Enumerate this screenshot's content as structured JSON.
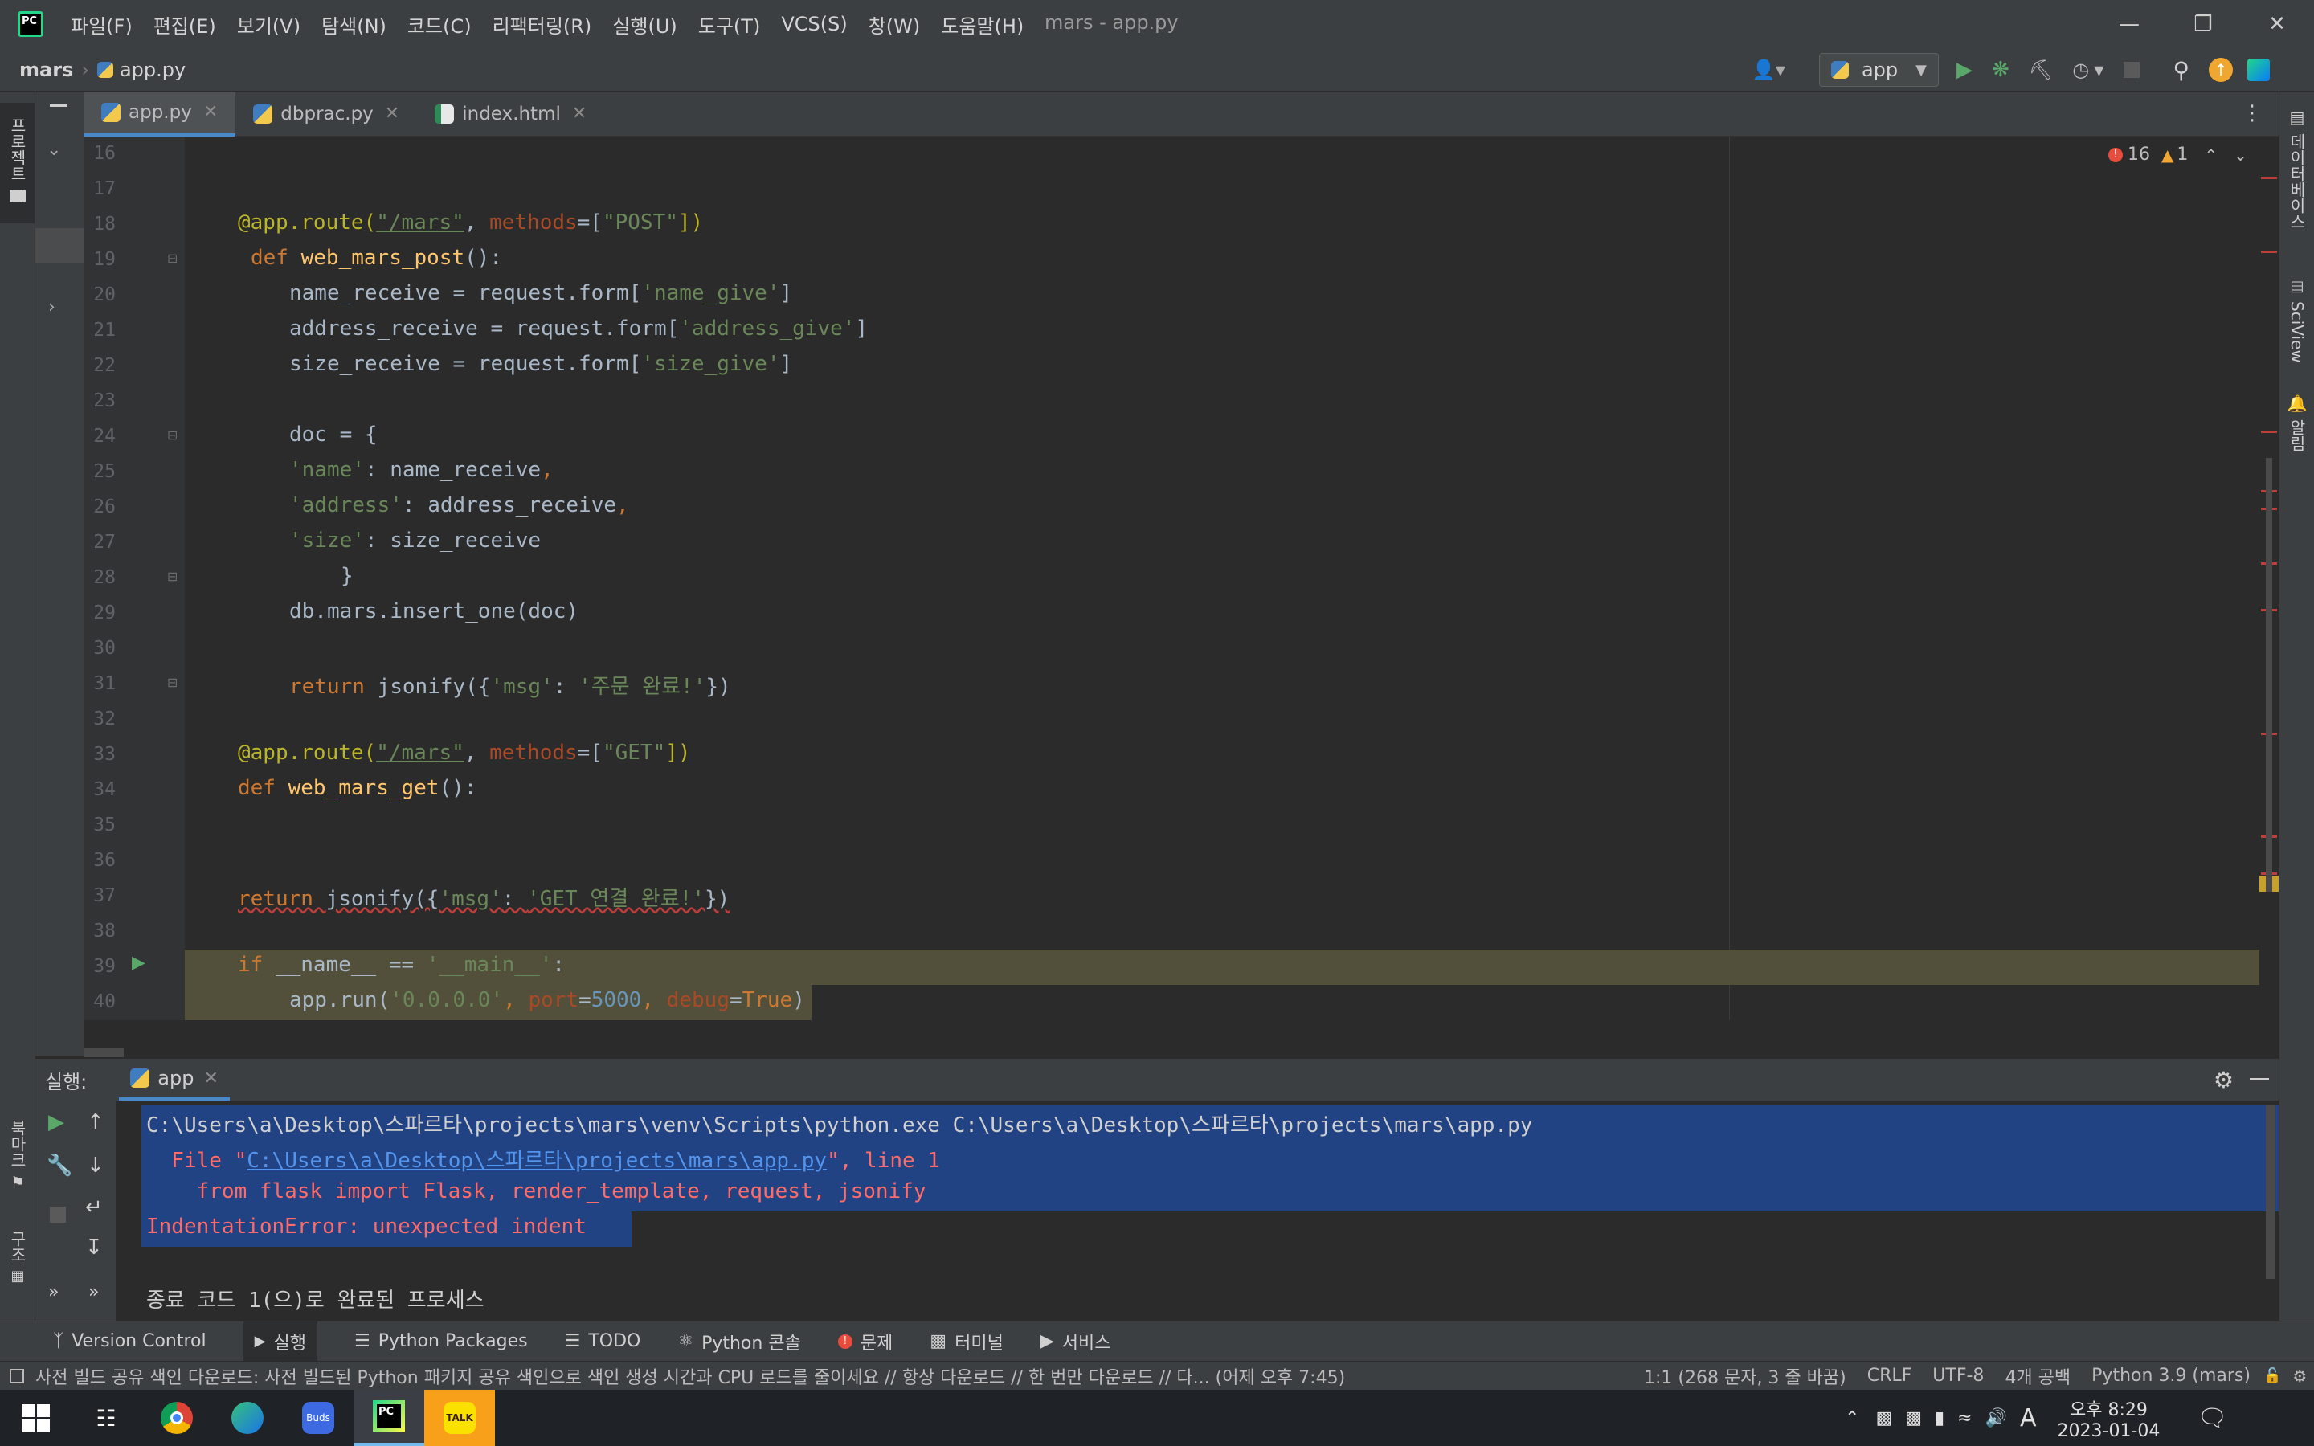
{
  "app": {
    "logo": "PC",
    "window_title": "mars - app.py"
  },
  "menu": [
    "파일(F)",
    "편집(E)",
    "보기(V)",
    "탐색(N)",
    "코드(C)",
    "리팩터링(R)",
    "실행(U)",
    "도구(T)",
    "VCS(S)",
    "창(W)",
    "도움말(H)"
  ],
  "nav": {
    "project": "mars",
    "file": "app.py",
    "run_config": "app"
  },
  "left_strip": {
    "project_label": "프로젝트",
    "bookmarks_label": "북마크",
    "structure_label": "구조"
  },
  "right_strip": {
    "database_label": "데이터베이스",
    "sciview_label": "SciView",
    "notifications_label": "알림"
  },
  "tabs": [
    {
      "label": "app.py",
      "icon": "python-file-icon",
      "active": true
    },
    {
      "label": "dbprac.py",
      "icon": "python-file-icon",
      "active": false
    },
    {
      "label": "index.html",
      "icon": "html-file-icon",
      "active": false
    }
  ],
  "inspections": {
    "errors": "16",
    "warnings": "1"
  },
  "line_numbers": [
    "16",
    "17",
    "18",
    "19",
    "20",
    "21",
    "22",
    "23",
    "24",
    "25",
    "26",
    "27",
    "28",
    "29",
    "30",
    "31",
    "32",
    "33",
    "34",
    "35",
    "36",
    "37",
    "38",
    "39",
    "40"
  ],
  "code": {
    "l18": {
      "a": "@app.route(",
      "b": "\"/mars\"",
      "c": ", ",
      "d": "methods",
      "e": "=[",
      "f": "\"POST\"",
      "g": "])"
    },
    "l19": {
      "a": "def ",
      "b": "web_mars_post",
      "c": "():"
    },
    "l20": {
      "a": "name_receive = request.form[",
      "b": "'name_give'",
      "c": "]"
    },
    "l21": {
      "a": "address_receive = request.form[",
      "b": "'address_give'",
      "c": "]"
    },
    "l22": {
      "a": "size_receive = request.form[",
      "b": "'size_give'",
      "c": "]"
    },
    "l24": {
      "a": "doc = {"
    },
    "l25": {
      "a": "'name'",
      "b": ": name_receive",
      "c": ","
    },
    "l26": {
      "a": "'address'",
      "b": ": address_receive",
      "c": ","
    },
    "l27": {
      "a": "'size'",
      "b": ": size_receive"
    },
    "l28": {
      "a": "}"
    },
    "l29": {
      "a": "db.mars.insert_one(doc)"
    },
    "l31": {
      "a": "return ",
      "b": "jsonify({",
      "c": "'msg'",
      "d": ": ",
      "e": "'주문 완료!'",
      "f": "})"
    },
    "l33": {
      "a": "@app.route(",
      "b": "\"/mars\"",
      "c": ", ",
      "d": "methods",
      "e": "=[",
      "f": "\"GET\"",
      "g": "])"
    },
    "l34": {
      "a": "def ",
      "b": "web_mars_get",
      "c": "():"
    },
    "l37": {
      "a": "return ",
      "b": "jsonify({",
      "c": "'msg'",
      "d": ": ",
      "e": "'GET 연결 완료!'",
      "f": "})"
    },
    "l39": {
      "a": "if ",
      "b": "__name__ == ",
      "c": "'__main__'",
      "d": ":"
    },
    "l40": {
      "a": "app.run(",
      "b": "'0.0.0.0'",
      "c": ", ",
      "d": "port",
      "e": "=",
      "f": "5000",
      "g": ", ",
      "h": "debug",
      "i": "=",
      "j": "True",
      "k": ")"
    }
  },
  "run": {
    "label": "실행:",
    "tab": "app",
    "output": {
      "cmd": "C:\\Users\\a\\Desktop\\스파르타\\projects\\mars\\venv\\Scripts\\python.exe C:\\Users\\a\\Desktop\\스파르타\\projects\\mars\\app.py",
      "file_prefix": "  File \"",
      "file_link": "C:\\Users\\a\\Desktop\\스파르타\\projects\\mars\\app.py",
      "file_suffix": "\", line 1",
      "import_line": "    from flask import Flask, render_template, request, jsonify",
      "error": "IndentationError: unexpected indent",
      "exit": "종료 코드 1(으)로 완료된 프로세스"
    }
  },
  "bottom_tabs": [
    "Version Control",
    "실행",
    "Python Packages",
    "TODO",
    "Python 콘솔",
    "문제",
    "터미널",
    "서비스"
  ],
  "status": {
    "message": "사전 빌드 공유 색인 다운로드: 사전 빌드된 Python 패키지 공유 색인으로 색인 생성 시간과 CPU 로드를 줄이세요 // 항상 다운로드 // 한 번만 다운로드 // 다... (어제 오후 7:45)",
    "position": "1:1 (268 문자, 3 줄 바꿈)",
    "line_sep": "CRLF",
    "encoding": "UTF-8",
    "indent": "4개 공백",
    "interpreter": "Python 3.9 (mars)"
  },
  "taskbar": {
    "time": "오후 8:29",
    "date": "2023-01-04",
    "ime": "A",
    "buds": "Buds",
    "talk": "TALK"
  },
  "colors": {
    "accent": "#4a88c7",
    "error": "#e74c3c",
    "warning": "#f0a732",
    "run_green": "#59a869",
    "selection": "#214283"
  }
}
